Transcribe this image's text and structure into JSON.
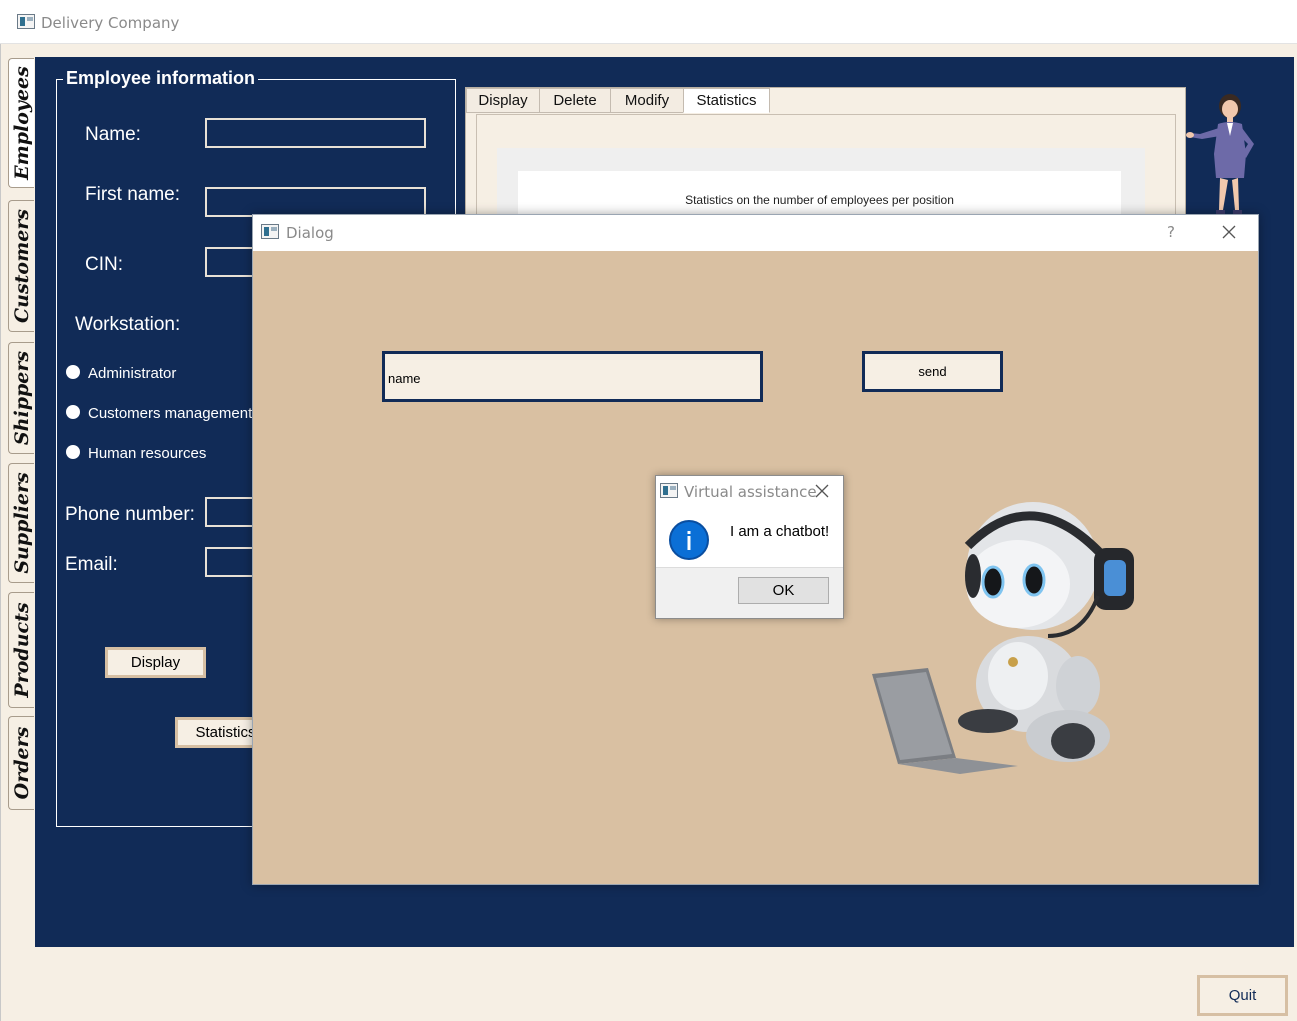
{
  "window": {
    "title": "Delivery Company"
  },
  "side_tabs": [
    {
      "label": "Employees",
      "active": true
    },
    {
      "label": "Customers"
    },
    {
      "label": "Shippers"
    },
    {
      "label": "Suppliers"
    },
    {
      "label": "Products"
    },
    {
      "label": "Orders"
    }
  ],
  "employee_form": {
    "group_title": "Employee information",
    "name_label": "Name:",
    "first_name_label": "First name:",
    "cin_label": "CIN:",
    "workstation_label": "Workstation:",
    "workstations": [
      "Administrator",
      "Customers management",
      "Human resources"
    ],
    "phone_label": "Phone number:",
    "email_label": "Email:",
    "display_button": "Display",
    "statistics_button": "Statistics"
  },
  "top_tabs": [
    {
      "label": "Display"
    },
    {
      "label": "Delete"
    },
    {
      "label": "Modify"
    },
    {
      "label": "Statistics",
      "active": true
    }
  ],
  "statistics": {
    "chart_title": "Statistics on the number of employees per position"
  },
  "dialog": {
    "title": "Dialog",
    "help_label": "?",
    "input_value": "name",
    "send_button": "send"
  },
  "message_box": {
    "title": "Virtual assistance",
    "message": "I am a chatbot!",
    "ok_button": "OK",
    "icon": "information-icon"
  },
  "footer": {
    "quit_button": "Quit"
  },
  "colors": {
    "navy": "#112b57",
    "beige": "#f6efe4",
    "tan": "#d9c0a2",
    "info_blue": "#0b6fd6"
  }
}
